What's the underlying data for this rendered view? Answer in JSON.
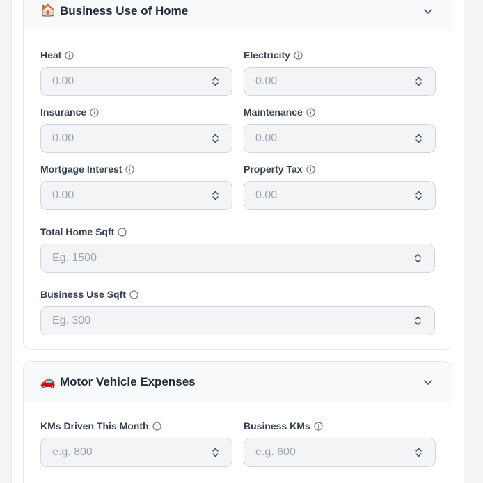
{
  "sections": {
    "home": {
      "emoji": "🏠",
      "title": "Business Use of Home",
      "fields": {
        "heat": {
          "label": "Heat",
          "placeholder": "0.00"
        },
        "electricity": {
          "label": "Electricity",
          "placeholder": "0.00"
        },
        "insurance": {
          "label": "Insurance",
          "placeholder": "0.00"
        },
        "maintenance": {
          "label": "Maintenance",
          "placeholder": "0.00"
        },
        "mortgage_interest": {
          "label": "Mortgage Interest",
          "placeholder": "0.00"
        },
        "property_tax": {
          "label": "Property Tax",
          "placeholder": "0.00"
        },
        "total_home_sqft": {
          "label": "Total Home Sqft",
          "placeholder": "Eg. 1500"
        },
        "business_use_sqft": {
          "label": "Business Use Sqft",
          "placeholder": "Eg. 300"
        }
      }
    },
    "vehicle": {
      "emoji": "🚗",
      "title": "Motor Vehicle Expenses",
      "fields": {
        "kms_driven": {
          "label": "KMs Driven This Month",
          "placeholder": "e.g. 800"
        },
        "business_kms": {
          "label": "Business KMs",
          "placeholder": "e.g. 600"
        }
      }
    }
  },
  "colors": {
    "background": "#f3f4f6",
    "card": "#ffffff",
    "header": "#f9fafb",
    "border": "#e5e7eb",
    "placeholder": "#9ca3af",
    "text": "#1f2937"
  }
}
